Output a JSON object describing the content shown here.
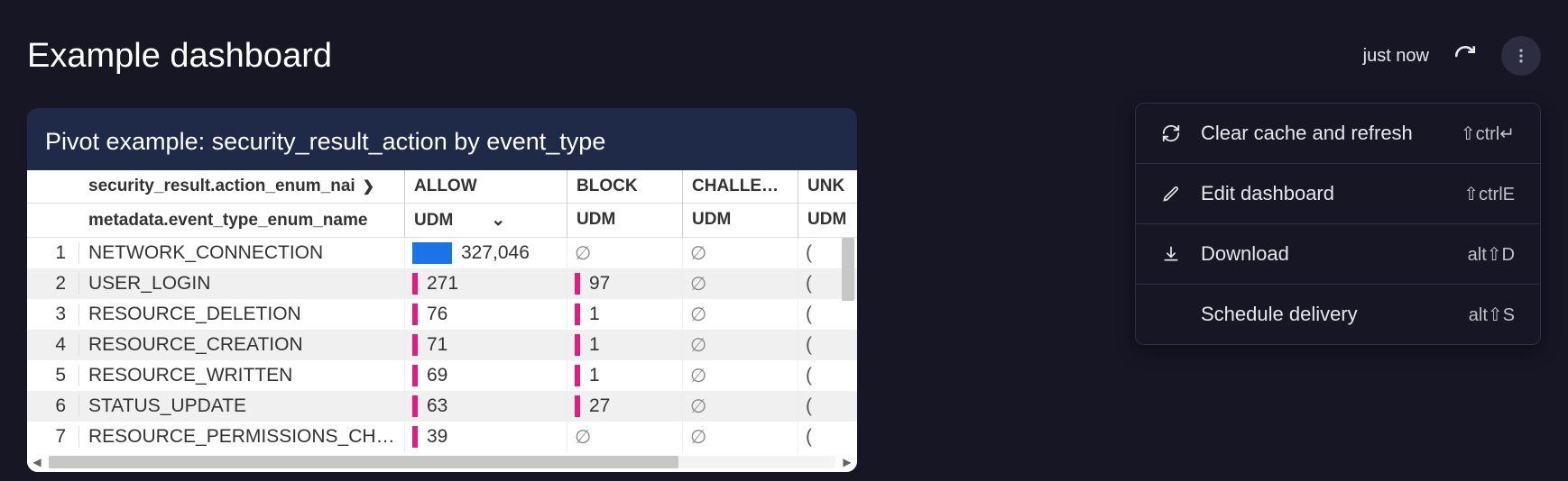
{
  "header": {
    "title": "Example dashboard",
    "last_refresh": "just now"
  },
  "tile": {
    "title": "Pivot example: security_result_action by event_type",
    "pivot_header": {
      "dimension_col1": "security_result.action_enum_nai",
      "dimension_col2": "metadata.event_type_enum_name",
      "pivots": [
        "ALLOW",
        "BLOCK",
        "CHALLE…",
        "UNK"
      ],
      "measure_label": "UDM"
    },
    "rows": [
      {
        "n": 1,
        "dim": "NETWORK_CONNECTION",
        "allow": "327,046",
        "allow_bar": "blue",
        "block": "∅",
        "chall": "∅",
        "unk": "("
      },
      {
        "n": 2,
        "dim": "USER_LOGIN",
        "allow": "271",
        "allow_bar": "pink",
        "block": "97",
        "block_bar": "pink",
        "chall": "∅",
        "unk": "("
      },
      {
        "n": 3,
        "dim": "RESOURCE_DELETION",
        "allow": "76",
        "allow_bar": "pink",
        "block": "1",
        "block_bar": "pink",
        "chall": "∅",
        "unk": "("
      },
      {
        "n": 4,
        "dim": "RESOURCE_CREATION",
        "allow": "71",
        "allow_bar": "pink",
        "block": "1",
        "block_bar": "pink",
        "chall": "∅",
        "unk": "("
      },
      {
        "n": 5,
        "dim": "RESOURCE_WRITTEN",
        "allow": "69",
        "allow_bar": "pink",
        "block": "1",
        "block_bar": "pink",
        "chall": "∅",
        "unk": "("
      },
      {
        "n": 6,
        "dim": "STATUS_UPDATE",
        "allow": "63",
        "allow_bar": "pink",
        "block": "27",
        "block_bar": "pink",
        "chall": "∅",
        "unk": "("
      },
      {
        "n": 7,
        "dim": "RESOURCE_PERMISSIONS_CHA…",
        "allow": "39",
        "allow_bar": "pink",
        "block": "∅",
        "chall": "∅",
        "unk": "("
      }
    ]
  },
  "menu": {
    "items": [
      {
        "icon": "refresh",
        "label": "Clear cache and refresh",
        "shortcut": "⇧ctrl↵"
      },
      {
        "icon": "pencil",
        "label": "Edit dashboard",
        "shortcut": "⇧ctrlE"
      },
      {
        "icon": "download",
        "label": "Download",
        "shortcut": "alt⇧D"
      },
      {
        "icon": "",
        "label": "Schedule delivery",
        "shortcut": "alt⇧S"
      }
    ]
  }
}
